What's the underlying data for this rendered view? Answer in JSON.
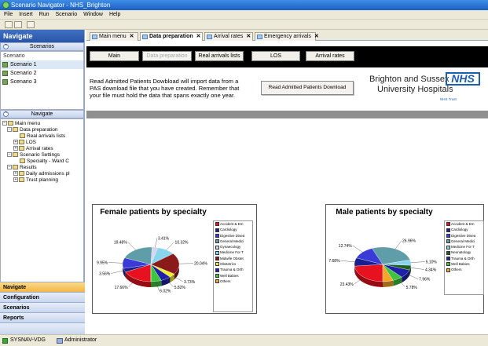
{
  "window": {
    "title": "Scenario Navigator - NHS_Brighton"
  },
  "menu": [
    "File",
    "Insert",
    "Run",
    "Scenario",
    "Window",
    "Help"
  ],
  "sidebar": {
    "header": "Navigate",
    "scenarios_section": "Scenarios",
    "scenarios_label": "Scenario",
    "scenarios": [
      "Scenario 1",
      "Scenario 2",
      "Scenario 3"
    ],
    "navigate_section": "Navigate",
    "tree": [
      {
        "label": "Main menu",
        "depth": 0
      },
      {
        "label": "Data preparation",
        "depth": 1
      },
      {
        "label": "Real arrivals lists",
        "depth": 2
      },
      {
        "label": "LOS",
        "depth": 2
      },
      {
        "label": "Arrival rates",
        "depth": 2
      },
      {
        "label": "Scenario Settings",
        "depth": 1
      },
      {
        "label": "Specialty - Ward C",
        "depth": 2
      },
      {
        "label": "Results",
        "depth": 1
      },
      {
        "label": "Daily admissions pl",
        "depth": 2
      },
      {
        "label": "Trust planning",
        "depth": 2
      }
    ],
    "bottom_buttons": [
      "Navigate",
      "Configuration",
      "Scenarios",
      "Reports"
    ]
  },
  "tabs": [
    {
      "label": "Main menu",
      "active": false
    },
    {
      "label": "Data preparation",
      "active": true
    },
    {
      "label": "Arrival rates",
      "active": false
    },
    {
      "label": "Emergency arrivals",
      "active": false
    }
  ],
  "nav_buttons": [
    {
      "label": "Main",
      "disabled": false
    },
    {
      "label": "Data preparation",
      "disabled": true
    },
    {
      "label": "Real arrivals lists",
      "disabled": false
    },
    {
      "label": "LOS",
      "disabled": false
    },
    {
      "label": "Arrival rates",
      "disabled": false
    }
  ],
  "info": {
    "text": "Read Admitted Patients Dowbload will import data from a PAS download file that you have created. Remember that your file must hold the data that spans exactly one year.",
    "button": "Read Admitted Patients Download"
  },
  "logo": {
    "line1": "Brighton and Sussex",
    "line2": "University Hospitals",
    "line3": "NHS Trust",
    "nhs": "NHS"
  },
  "legend_items": [
    {
      "label": "Accident & Em",
      "color": "#e8111f"
    },
    {
      "label": "Cardiology",
      "color": "#1a1f8f"
    },
    {
      "label": "Digestive Disea",
      "color": "#3a3ad8"
    },
    {
      "label": "General Medici",
      "color": "#5f9ea8"
    },
    {
      "label": "Gynaecology",
      "color": "#d5d5ef"
    },
    {
      "label": "Medicine For T",
      "color": "#89d4ef"
    },
    {
      "label": "Midwife Obstet",
      "color": "#8b1a1a"
    },
    {
      "label": "Obstetrics",
      "color": "#f0ef2a"
    },
    {
      "label": "Trauma & Orth",
      "color": "#1f1fa8"
    },
    {
      "label": "Well Babies",
      "color": "#3ec43e"
    },
    {
      "label": "Others",
      "color": "#f4a62c"
    }
  ],
  "male_legend_items": [
    {
      "label": "Accident & Em",
      "color": "#e8111f"
    },
    {
      "label": "Cardiology",
      "color": "#1a1f8f"
    },
    {
      "label": "Digestive Disea",
      "color": "#3a3ad8"
    },
    {
      "label": "General Medici",
      "color": "#5f9ea8"
    },
    {
      "label": "Medicine For T",
      "color": "#89d4ef"
    },
    {
      "label": "Neonatology",
      "color": "#1e5e1e"
    },
    {
      "label": "Trauma & Orth",
      "color": "#1f1fa8"
    },
    {
      "label": "Well Babies",
      "color": "#3ec43e"
    },
    {
      "label": "Others",
      "color": "#f4a62c"
    }
  ],
  "chart_data": [
    {
      "type": "pie",
      "title": "Female patients by specialty",
      "categories": [
        "Accident & Em",
        "Cardiology",
        "Digestive Disea",
        "General Medici",
        "Gynaecology",
        "Medicine For T",
        "Midwife Obstet",
        "Obstetrics",
        "Trauma & Orth",
        "Well Babies",
        "Others"
      ],
      "values": [
        17.66,
        3.56,
        9.95,
        19.48,
        3.41,
        10.32,
        20.04,
        3.73,
        5.82,
        6.02,
        0.01
      ],
      "labels": [
        "17.66%",
        "3.56%",
        "9.95%",
        "19.48%",
        "3.41%",
        "10.32%",
        "20.04%",
        "3.73%",
        "5.82%",
        "6.02%"
      ]
    },
    {
      "type": "pie",
      "title": "Male patients by specialty",
      "categories": [
        "Accident & Em",
        "Cardiology",
        "Digestive Disea",
        "General Medici",
        "Medicine For T",
        "Neonatology",
        "Trauma & Orth",
        "Well Babies",
        "Others"
      ],
      "values": [
        23.43,
        7.68,
        12.74,
        26.96,
        5.1,
        4.34,
        7.96,
        5.78,
        6.01
      ],
      "labels": [
        "23.43%",
        "7.68%",
        "12.74%",
        "26.96%",
        "5.10%",
        "4.34%",
        "7.96%",
        "5.78%"
      ]
    }
  ],
  "status": {
    "left": "SYSNAV-VDG",
    "right": "Administrator"
  }
}
